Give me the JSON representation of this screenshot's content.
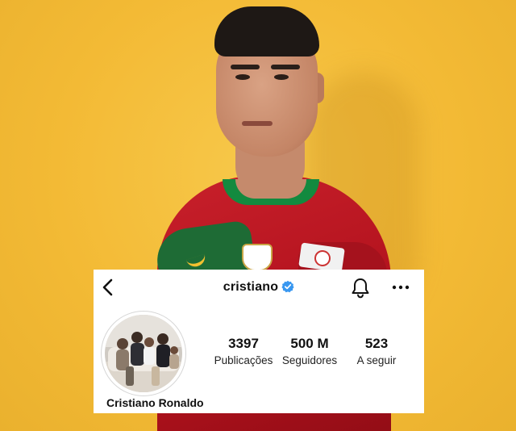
{
  "profile": {
    "username": "cristiano",
    "full_name": "Cristiano Ronaldo",
    "verified": true
  },
  "stats": [
    {
      "value": "3397",
      "label": "Publicações"
    },
    {
      "value": "500 M",
      "label": "Seguidores"
    },
    {
      "value": "523",
      "label": "A seguir"
    }
  ],
  "icons": {
    "back": "chevron-left-icon",
    "verified": "verified-badge-icon",
    "bell": "bell-icon",
    "more": "more-horizontal-icon"
  },
  "colors": {
    "background": "#f4bd3a",
    "jersey_red": "#b2121d",
    "jersey_green": "#138a3f",
    "verified_blue": "#3897f0",
    "card": "#ffffff"
  }
}
